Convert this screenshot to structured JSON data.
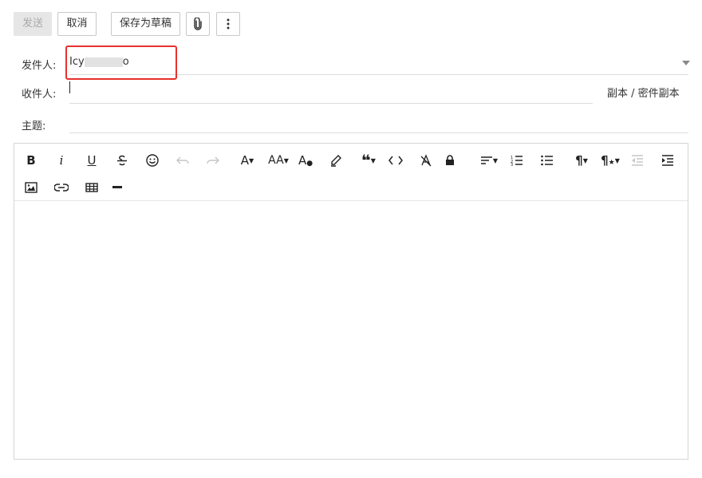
{
  "toolbar": {
    "send": "发送",
    "cancel": "取消",
    "save_draft": "保存为草稿",
    "attach_icon": "paperclip-icon",
    "more_icon": "more-vertical-icon"
  },
  "form": {
    "from_label": "发件人:",
    "from_value_start": "Icy",
    "from_value_end": "o",
    "to_label": "收件人:",
    "to_value": "",
    "cc_bcc": "副本 / 密件副本",
    "subject_label": "主题:",
    "subject_value": ""
  },
  "editor": {
    "bold": "B",
    "italic": "i",
    "underline": "U",
    "font_family": "A",
    "font_size": "AA",
    "color": "A",
    "paragraph": "¶",
    "body": ""
  },
  "colors": {
    "highlight": "#e8312b",
    "border": "#d5d5d5"
  }
}
